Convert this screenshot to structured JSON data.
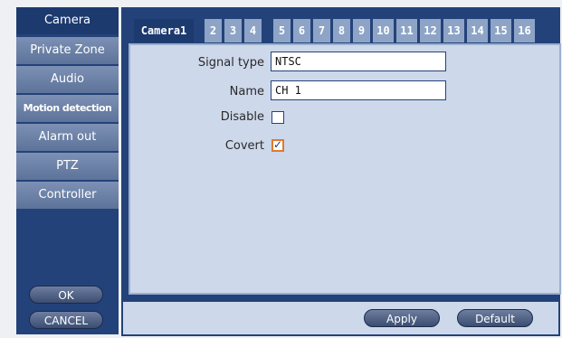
{
  "sidebar": {
    "items": [
      {
        "label": "Camera"
      },
      {
        "label": "Private Zone"
      },
      {
        "label": "Audio"
      },
      {
        "label": "Motion detection"
      },
      {
        "label": "Alarm out"
      },
      {
        "label": "PTZ"
      },
      {
        "label": "Controller"
      }
    ],
    "ok_label": "OK",
    "cancel_label": "CANCEL"
  },
  "tabs": [
    "Camera1",
    "2",
    "3",
    "4",
    "5",
    "6",
    "7",
    "8",
    "9",
    "10",
    "11",
    "12",
    "13",
    "14",
    "15",
    "16"
  ],
  "form": {
    "signal_type_label": "Signal type",
    "signal_type_value": "NTSC",
    "name_label": "Name",
    "name_value": "CH 1",
    "disable_label": "Disable",
    "disable_checked": false,
    "covert_label": "Covert",
    "covert_checked": true
  },
  "actions": {
    "apply_label": "Apply",
    "default_label": "Default"
  },
  "colors": {
    "panel_bg": "#24427a",
    "content_bg": "#cdd8ea",
    "focus_accent": "#e07a2e"
  }
}
